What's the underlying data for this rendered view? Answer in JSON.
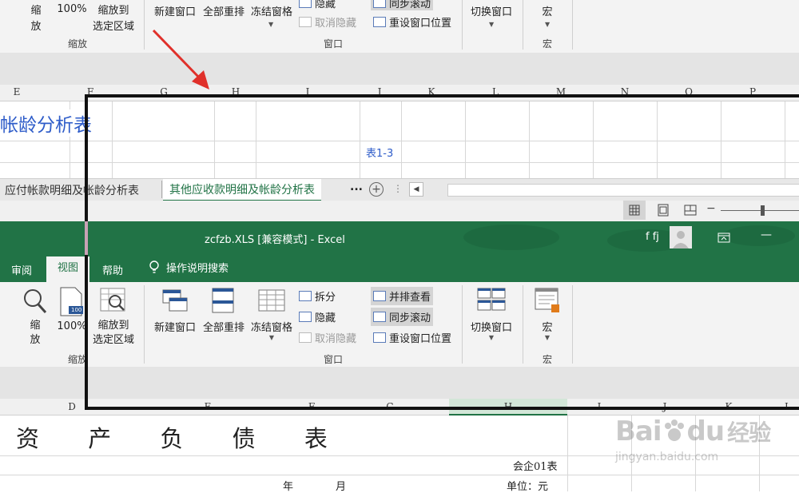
{
  "top_ribbon": {
    "zoom_label_a": "缩",
    "zoom_label_b": "放",
    "zoom100": "100%",
    "zoom_sel_a": "缩放到",
    "zoom_sel_b": "选定区域",
    "new_window": "新建窗口",
    "arrange_all": "全部重排",
    "freeze": "冻结窗格",
    "hide": "隐藏",
    "unhide": "取消隐藏",
    "sync_scroll": "同步滚动",
    "reset_pos": "重设窗口位置",
    "switch_window": "切换窗口",
    "macro": "宏",
    "group_zoom": "缩放",
    "group_window": "窗口",
    "group_macro": "宏"
  },
  "top_sheet": {
    "col_headers": [
      "E",
      "F",
      "G",
      "H",
      "I",
      "J",
      "K",
      "L",
      "M",
      "N",
      "O",
      "P"
    ],
    "title": "帐龄分析表",
    "table_no": "表1-3",
    "tabs": [
      "应付帐款明细及帐龄分析表",
      "其他应收款明细及帐龄分析表"
    ],
    "tab_more": "...",
    "tab_add": "+"
  },
  "titlebar": {
    "filename": "zcfzb.XLS",
    "mode": "[兼容模式]",
    "dash": "-",
    "app": "Excel",
    "user": "f fj",
    "minimize": "—"
  },
  "menu": {
    "items": [
      "审阅",
      "视图",
      "帮助",
      "操作说明搜索"
    ],
    "active": "视图"
  },
  "ribbon": {
    "zoom_a": "缩",
    "zoom_b": "放",
    "zoom100": "100%",
    "zoom_icon_text": "100",
    "zoom_sel_a": "缩放到",
    "zoom_sel_b": "选定区域",
    "new_window": "新建窗口",
    "arrange_all": "全部重排",
    "freeze": "冻结窗格",
    "split": "拆分",
    "hide": "隐藏",
    "unhide": "取消隐藏",
    "side_by_side": "并排查看",
    "sync_scroll": "同步滚动",
    "reset_pos": "重设窗口位置",
    "switch_window": "切换窗口",
    "macro": "宏",
    "group_zoom": "缩放",
    "group_window": "窗口",
    "group_macro": "宏"
  },
  "sheet": {
    "col_headers": [
      "D",
      "E",
      "F",
      "G",
      "H",
      "I",
      "J",
      "K",
      "L"
    ],
    "title": "资 产 负 债 表",
    "form_no": "会企01表",
    "year": "年",
    "month": "月",
    "unit": "单位：元"
  },
  "watermark": {
    "brand": "Bai",
    "brand2": "du",
    "cn": "经验",
    "url": "jingyan.baidu.com"
  },
  "colors": {
    "excel_green": "#217346",
    "accent_blue": "#2e5cc9",
    "arrow_red": "#e0302a"
  }
}
